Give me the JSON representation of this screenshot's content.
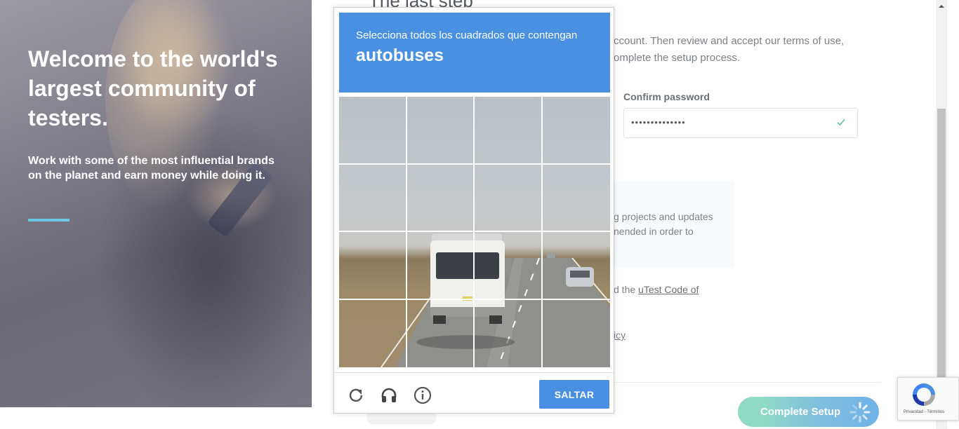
{
  "hero": {
    "title": "Welcome to the world's largest community of testers.",
    "subtitle": "Work with some of the most influential brands on the planet and earn money while doing it."
  },
  "page": {
    "heading": "The last step",
    "intro": "ccount. Then review and accept our terms of use, omplete the setup process.",
    "confirm_password_label": "Confirm password",
    "confirm_password_value": "••••••••••••••",
    "info_text": "g projects and updates nended in order to",
    "code_prefix": "d the ",
    "code_link": "uTest Code of",
    "policy_fragment": "icy",
    "complete_button": "Complete Setup"
  },
  "captcha": {
    "instruction": "Selecciona todos los cuadrados que contengan",
    "target": "autobuses",
    "skip_label": "SALTAR",
    "tile_count": 16
  },
  "recaptcha_badge": {
    "links": "Privacidad - Términos"
  },
  "colors": {
    "captcha_blue": "#4a90e2",
    "hero_accent": "#6cc7e1",
    "check_green": "#5cc08e"
  },
  "icons": {
    "reload": "reload-icon",
    "audio": "headphones-icon",
    "info": "info-icon",
    "check": "check-icon",
    "spinner": "spinner-icon"
  }
}
